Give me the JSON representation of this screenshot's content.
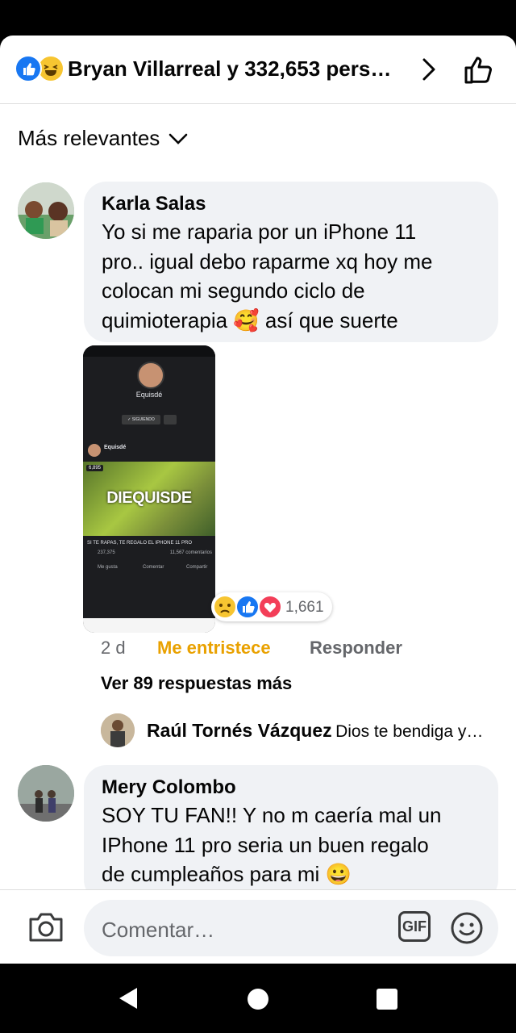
{
  "header": {
    "title": "Bryan Villarreal y 332,653 pers…"
  },
  "sort": {
    "label": "Más relevantes"
  },
  "comments": [
    {
      "author": "Karla Salas",
      "lines": [
        "Yo si me raparia por un iPhone 11",
        "pro.. igual debo raparme xq hoy me",
        "colocan mi segundo ciclo de",
        "quimioterapia 🥰 así que suerte"
      ],
      "image": {
        "profile_name": "Equisdé",
        "following_label": "✓ SIGUIENDO",
        "post_author": "Equisdé",
        "post_count": "6,895",
        "banner_text": "DIEQUISDE",
        "caption": "SI TE RAPAS, TE REGALO EL IPHONE 11 PRO",
        "reaction_count": "237,375",
        "comments_count": "11,567 comentarios",
        "action_like": "Me gusta",
        "action_comment": "Comentar",
        "action_share": "Compartir"
      },
      "reaction_count": "1,661",
      "time": "2 d",
      "reaction_label": "Me entristece",
      "reply_label": "Responder",
      "more_replies": "Ver 89 respuestas más",
      "reply_preview": {
        "author": "Raúl Tornés Vázquez",
        "text": "Dios te bendiga y…"
      }
    },
    {
      "author": "Mery Colombo",
      "lines": [
        "SOY TU FAN!! Y no m caería mal un",
        "IPhone 11 pro seria un buen regalo",
        "de cumpleaños para mi 😀"
      ]
    }
  ],
  "composer": {
    "placeholder": "Comentar…",
    "gif_label": "GIF"
  },
  "colors": {
    "accent_blue": "#1877f2",
    "sad_reaction": "#e9a100",
    "bubble_bg": "#f0f2f5"
  },
  "icons": [
    "like-reaction-icon",
    "haha-reaction-icon",
    "chevron-right-icon",
    "thumbs-up-icon",
    "chevron-down-icon",
    "sad-reaction-icon",
    "love-reaction-icon",
    "camera-icon",
    "gif-icon",
    "emoji-icon",
    "back-icon",
    "home-icon",
    "recents-icon"
  ]
}
